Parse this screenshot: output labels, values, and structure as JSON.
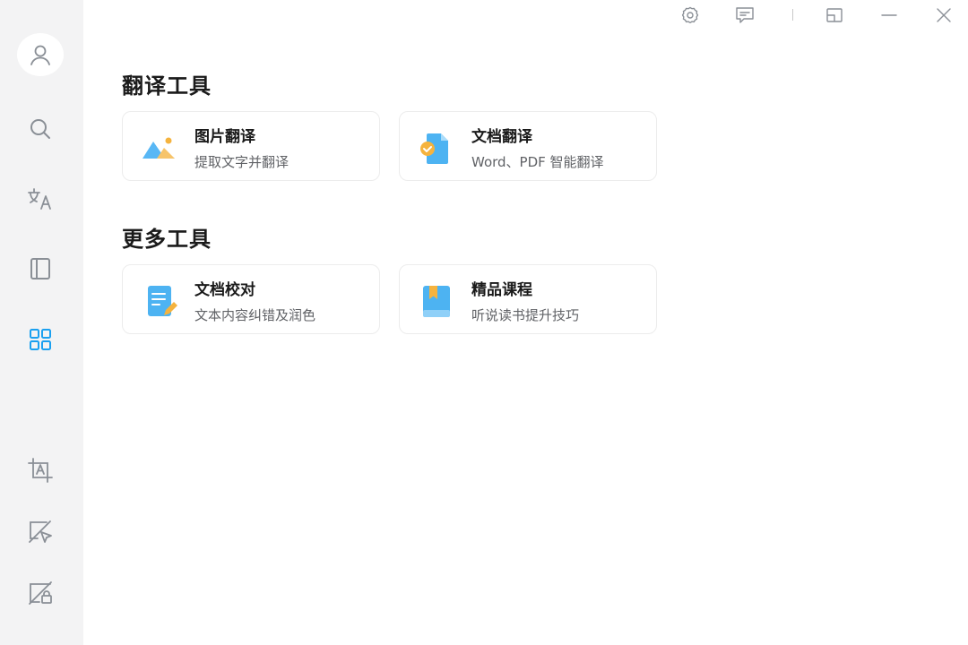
{
  "sidebar": {
    "items": [
      {
        "icon": "user-icon"
      },
      {
        "icon": "search-icon"
      },
      {
        "icon": "translate-icon"
      },
      {
        "icon": "book-icon"
      },
      {
        "icon": "grid-icon",
        "active": true
      },
      {
        "icon": "screenshot-translate-icon"
      },
      {
        "icon": "pointer-translate-icon"
      },
      {
        "icon": "image-edit-icon"
      }
    ],
    "active_color": "#1aa0f0",
    "icon_color": "#8a8f96"
  },
  "window_controls": [
    "settings-icon",
    "feedback-icon",
    "restore-icon",
    "minimize-icon",
    "close-icon"
  ],
  "sections": [
    {
      "title": "翻译工具",
      "cards": [
        {
          "title": "图片翻译",
          "subtitle": "提取文字并翻译",
          "icon": "image-translate-icon"
        },
        {
          "title": "文档翻译",
          "subtitle": "Word、PDF 智能翻译",
          "icon": "document-translate-icon"
        }
      ]
    },
    {
      "title": "更多工具",
      "cards": [
        {
          "title": "文档校对",
          "subtitle": "文本内容纠错及润色",
          "icon": "document-proofread-icon"
        },
        {
          "title": "精品课程",
          "subtitle": "听说读书提升技巧",
          "icon": "course-icon"
        }
      ]
    }
  ]
}
